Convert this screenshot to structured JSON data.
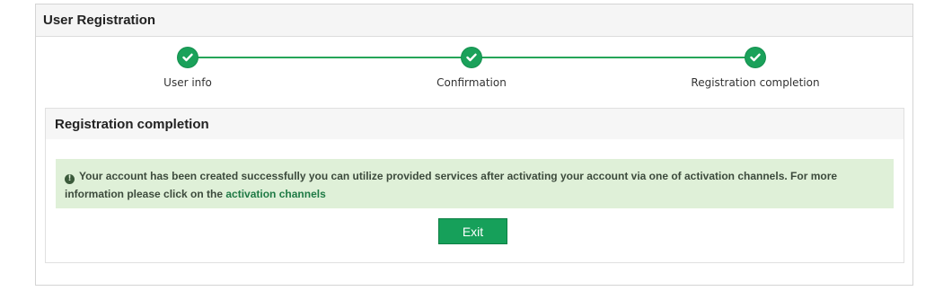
{
  "panel": {
    "title": "User Registration"
  },
  "steps": [
    {
      "label": "User info"
    },
    {
      "label": "Confirmation"
    },
    {
      "label": "Registration completion"
    }
  ],
  "completion": {
    "title": "Registration completion",
    "message_prefix": "Your account has been created successfully you can utilize provided services after activating your account via one of activation channels. For more information please click on the ",
    "link_text": "activation channels",
    "exit_label": "Exit"
  },
  "colors": {
    "accent": "#1aa15a",
    "alert_bg": "#dff0d8"
  },
  "icons": {
    "step_done": "check-icon",
    "alert": "info-circle-icon"
  }
}
